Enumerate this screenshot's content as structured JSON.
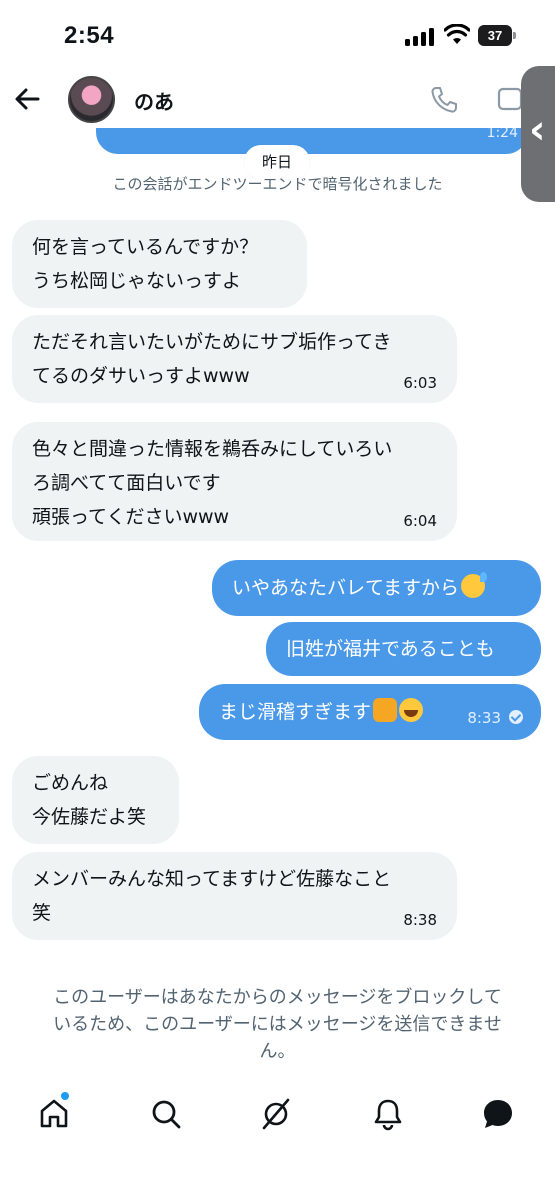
{
  "status_bar": {
    "time": "2:54",
    "battery": "37"
  },
  "header": {
    "name": "のあ"
  },
  "prev_message": {
    "time": "1:24"
  },
  "date_chip": "昨日",
  "encryption_note": "この会話がエンドツーエンドで暗号化されました",
  "messages": [
    {
      "dir": "in",
      "lines": [
        "何を言っているんですか？",
        "うち松岡じゃないっすよ"
      ],
      "time": ""
    },
    {
      "dir": "in",
      "lines": [
        "ただそれ言いたいがためにサブ垢作ってき",
        "てるのダサいっすよwww"
      ],
      "time": "6:03"
    },
    {
      "dir": "in",
      "lines": [
        "色々と間違った情報を鵜呑みにしていろい",
        "ろ調べてて面白いです",
        "頑張ってくださいwww"
      ],
      "time": "6:04"
    },
    {
      "dir": "out",
      "text": "いやあなたバレてますから",
      "emoji": [
        "sweat-smile-emoji"
      ],
      "time": ""
    },
    {
      "dir": "out",
      "text": "旧姓が福井であることも",
      "time": ""
    },
    {
      "dir": "out",
      "text": "まじ滑稽すぎます",
      "emoji": [
        "fist-emoji",
        "joy-emoji"
      ],
      "time": "8:33",
      "read": true
    },
    {
      "dir": "in",
      "lines": [
        "ごめんね",
        "今佐藤だよ笑"
      ],
      "time": ""
    },
    {
      "dir": "in",
      "lines": [
        "メンバーみんな知ってますけど佐藤なこと",
        "笑"
      ],
      "time": "8:38"
    }
  ],
  "block_note_lines": [
    "このユーザーはあなたからのメッセージをブロックして",
    "いるため、このユーザーにはメッセージを送信できませ",
    "ん。"
  ],
  "nav": [
    "home-icon",
    "search-icon",
    "grok-icon",
    "notifications-icon",
    "messages-icon"
  ],
  "colors": {
    "accent": "#1d9bf0",
    "outgoing": "#4a99e9",
    "incoming": "#eff3f4",
    "muted": "#536471"
  }
}
